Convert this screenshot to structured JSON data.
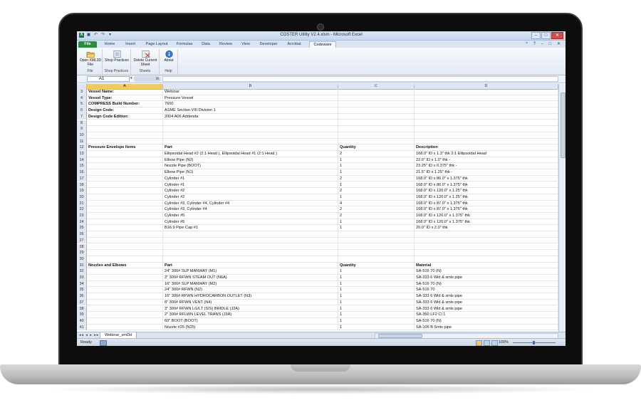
{
  "window": {
    "title": "COSTER Utility V2.4.xlsm - Microsoft Excel",
    "controls": [
      "–",
      "□",
      "✕"
    ]
  },
  "ribbon_tabs": [
    "File",
    "Home",
    "Insert",
    "Page Layout",
    "Formulas",
    "Data",
    "Review",
    "View",
    "Developer",
    "Acrobat",
    "Codeware"
  ],
  "active_tab": "Codeware",
  "ribbon": {
    "groups": [
      {
        "label": "File",
        "buttons": [
          {
            "label": "Open XML3D File",
            "icon": "folder-open-icon"
          }
        ]
      },
      {
        "label": "Shop Practices",
        "buttons": [
          {
            "label": "Shop Practices",
            "icon": "shop-practices-icon"
          }
        ]
      },
      {
        "label": "Sheets",
        "buttons": [
          {
            "label": "Delete Current Sheet",
            "icon": "delete-sheet-icon"
          }
        ]
      },
      {
        "label": "Help",
        "buttons": [
          {
            "label": "About",
            "icon": "info-icon"
          }
        ]
      }
    ]
  },
  "formula_bar": {
    "name_box": "A1",
    "fx": "fx",
    "value": ""
  },
  "columns": [
    "A",
    "B",
    "C",
    "D"
  ],
  "rows": [
    {
      "n": "3",
      "a": "Vessel Name:",
      "b": "Webinar",
      "c": "",
      "d": ""
    },
    {
      "n": "4",
      "a": "Vessel Type:",
      "b": "Pressure Vessel",
      "c": "",
      "d": ""
    },
    {
      "n": "5",
      "a": "COMPRESS Build Number:",
      "b": "7600",
      "c": "",
      "d": ""
    },
    {
      "n": "6",
      "a": "Design Code:",
      "b": "ASME Section VIII Division 1",
      "c": "",
      "d": ""
    },
    {
      "n": "7",
      "a": "Design Code Edition:",
      "b": "2004 A06 Addenda",
      "c": "",
      "d": ""
    },
    {
      "n": "8",
      "a": "",
      "b": "",
      "c": "",
      "d": ""
    },
    {
      "n": "9",
      "a": "",
      "b": "",
      "c": "",
      "d": ""
    },
    {
      "n": "10",
      "a": "",
      "b": "",
      "c": "",
      "d": ""
    },
    {
      "n": "11",
      "a": "",
      "b": "",
      "c": "",
      "d": ""
    },
    {
      "n": "12",
      "a": "Pressure Envelope Items",
      "b": "Part",
      "c": "Quantity",
      "d": "Description",
      "header": true
    },
    {
      "n": "13",
      "a": "",
      "b": "Ellipsoidal Head #2  (2:1 Head ), Ellipsoidal Head #1  (2:1 Head )",
      "c": "2",
      "d": "168.0\" ID x 1.3\" thk   2:1 Ellipsoidal Head"
    },
    {
      "n": "14",
      "a": "",
      "b": "Elbow Pipe (N2)",
      "c": "1",
      "d": "22.0\" ID x 1.0\" thk -"
    },
    {
      "n": "15",
      "a": "",
      "b": "Nozzle Pipe (BOOT)",
      "c": "1",
      "d": "23.25\" ID x 0.375\" thk -"
    },
    {
      "n": "16",
      "a": "",
      "b": "Elbow Pipe (N1)",
      "c": "1",
      "d": "21.5\" ID x 1.25\" thk -"
    },
    {
      "n": "17",
      "a": "",
      "b": "Cylinder #1",
      "c": "2",
      "d": "168.0\" ID x 86.0\" x 1.375\" thk"
    },
    {
      "n": "18",
      "a": "",
      "b": "Cylinder #1",
      "c": "1",
      "d": "168.0\" ID x 86.0\" x 1.375\" thk"
    },
    {
      "n": "19",
      "a": "",
      "b": "Cylinder #2",
      "c": "2",
      "d": "168.0\" ID x 120.0\" x 1.25\" thk"
    },
    {
      "n": "20",
      "a": "",
      "b": "Cylinder #2",
      "c": "1",
      "d": "168.0\" ID x 120.0\" x 1.25\" thk"
    },
    {
      "n": "21",
      "a": "",
      "b": "Cylinder #3, Cylinder #4, Cylinder #4",
      "c": "4",
      "d": "168.0\" ID x 87.0\" x 1.375\" thk"
    },
    {
      "n": "22",
      "a": "",
      "b": "Cylinder #3, Cylinder #4",
      "c": "2",
      "d": "168.0\" ID x 87.0\" x 1.375\" thk"
    },
    {
      "n": "23",
      "a": "",
      "b": "Cylinder #5",
      "c": "2",
      "d": "168.0\" ID x 120.0\" x 1.375\" thk"
    },
    {
      "n": "24",
      "a": "",
      "b": "Cylinder #5",
      "c": "1",
      "d": "168.0\" ID x 120.0\" x 1.375\" thk"
    },
    {
      "n": "25",
      "a": "",
      "b": "B16.9 Pipe Cap #1",
      "c": "1",
      "d": "20.0\" ID x 2.0\" thk"
    },
    {
      "n": "26",
      "a": "",
      "b": "",
      "c": "",
      "d": ""
    },
    {
      "n": "27",
      "a": "",
      "b": "",
      "c": "",
      "d": ""
    },
    {
      "n": "28",
      "a": "",
      "b": "",
      "c": "",
      "d": ""
    },
    {
      "n": "29",
      "a": "",
      "b": "",
      "c": "",
      "d": ""
    },
    {
      "n": "30",
      "a": "",
      "b": "",
      "c": "",
      "d": ""
    },
    {
      "n": "31",
      "a": "Nozzles and Elbows",
      "b": "Part",
      "c": "Quantity",
      "d": "Material",
      "header": true
    },
    {
      "n": "32",
      "a": "",
      "b": "24\" 300# SLP MANWAY (M1)",
      "c": "1",
      "d": "SA-516 70 (N)"
    },
    {
      "n": "33",
      "a": "",
      "b": "3\" 300# RFWN STEAM OUT (N6A)",
      "c": "1",
      "d": "SA-333 6 Wld & smls pipe"
    },
    {
      "n": "34",
      "a": "",
      "b": "16\" 300# SLP MANWAY (M2)",
      "c": "1",
      "d": "SA-516 70 (N)"
    },
    {
      "n": "35",
      "a": "",
      "b": "24\" 300# RFWN (N2)",
      "c": "1",
      "d": "SA-516 70"
    },
    {
      "n": "36",
      "a": "",
      "b": "16\" 300# RFWN HYDROCARBON OUTLET (N3)",
      "c": "1",
      "d": "SA-333 6 Wld & smls pipe"
    },
    {
      "n": "37",
      "a": "",
      "b": "8\" 300# RFWN VENT (N4)",
      "c": "1",
      "d": "SA-333 6 Wld & smls pipe"
    },
    {
      "n": "38",
      "a": "",
      "b": "3\" 300# RFWN LG/LT (SIS) BRIDLE (J2A)",
      "c": "1",
      "d": "SA-333 6 Wld & smls pipe"
    },
    {
      "n": "39",
      "a": "",
      "b": "2\" 300# RFLWN LEVEL TRANS (J3A)",
      "c": "1",
      "d": "SA-350 LF2 Cl 1"
    },
    {
      "n": "40",
      "a": "",
      "b": "60\" BOOT (BOOT)",
      "c": "1",
      "d": "SA-516 70 (N)"
    },
    {
      "n": "41",
      "a": "",
      "b": "Nozzle #25 (N25)",
      "c": "1",
      "d": "SA-106 B Smls pipe"
    }
  ],
  "sheet_tab": "Webinar_xml3d",
  "status": {
    "mode": "Ready",
    "zoom": "100%"
  }
}
